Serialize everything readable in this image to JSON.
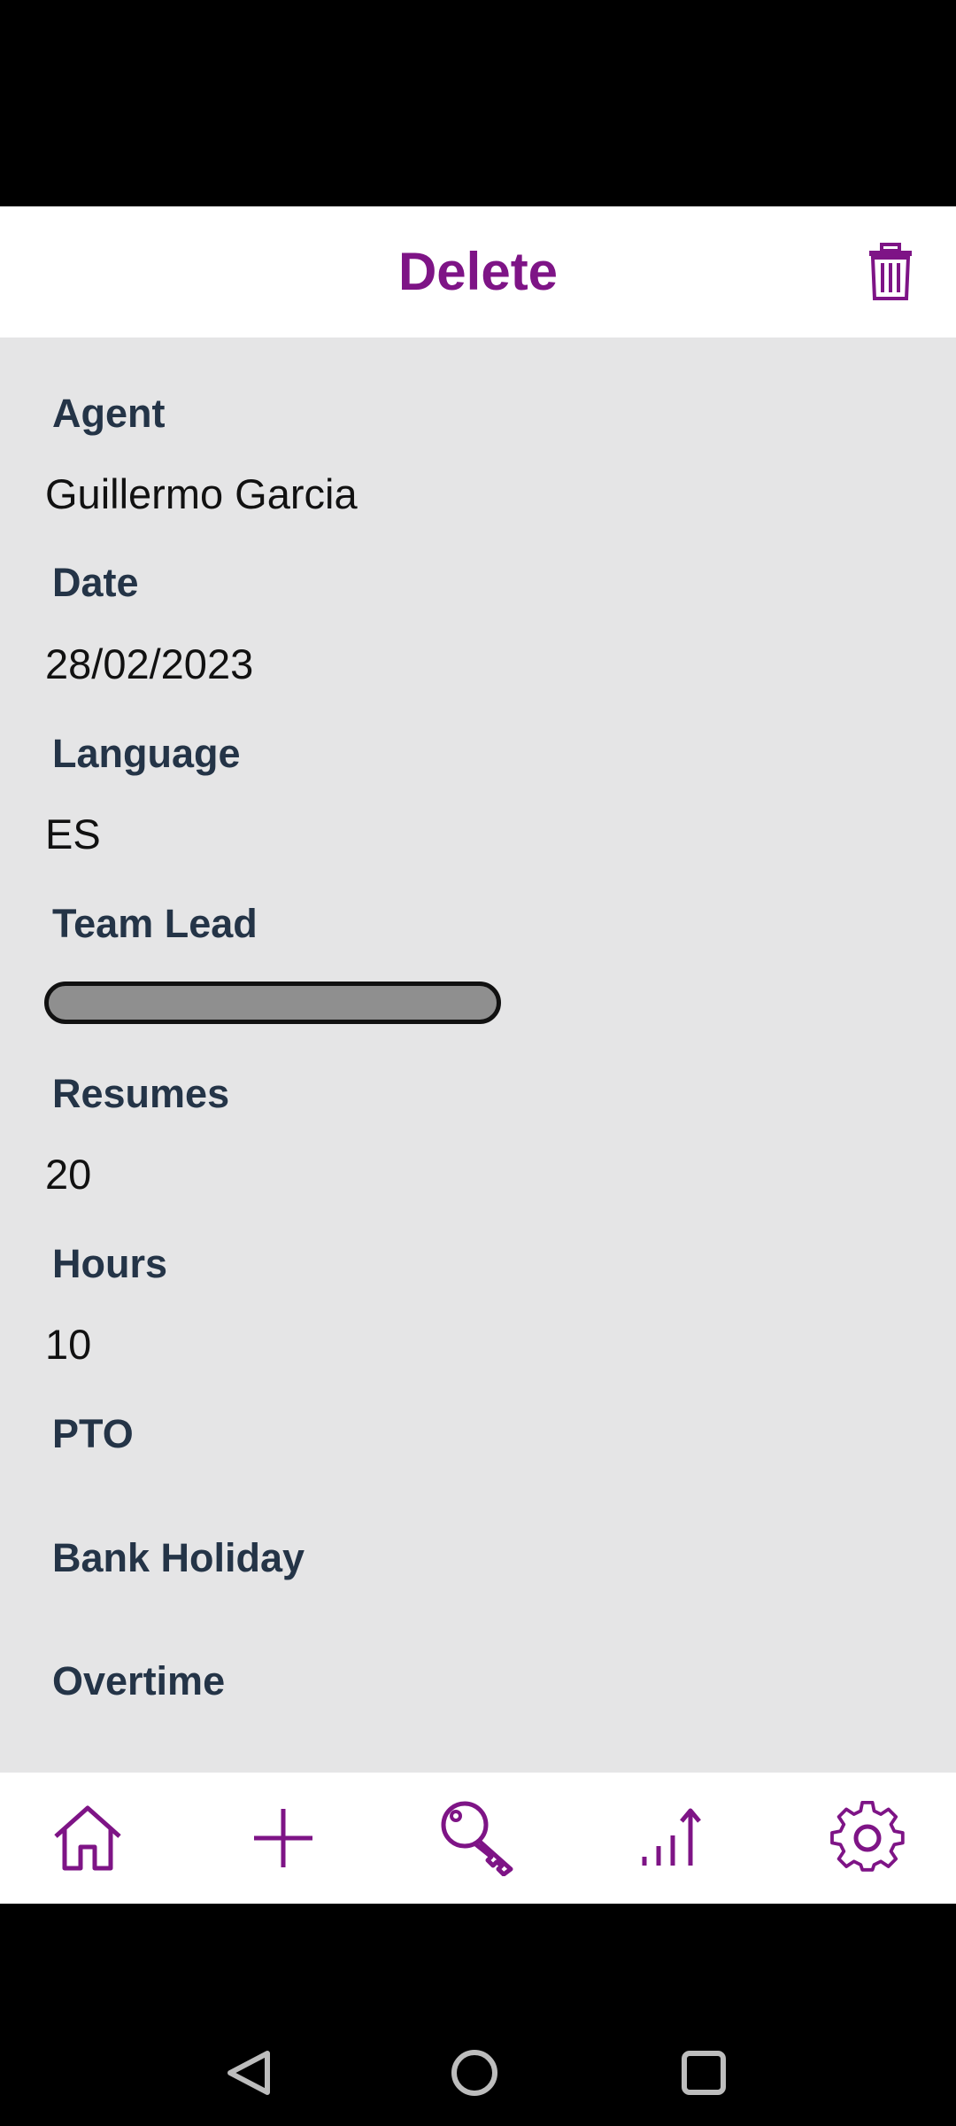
{
  "header": {
    "title": "Delete",
    "action_icon": "trash-icon"
  },
  "fields": {
    "agent": {
      "label": "Agent",
      "value": "Guillermo Garcia"
    },
    "date": {
      "label": "Date",
      "value": "28/02/2023"
    },
    "language": {
      "label": "Language",
      "value": "ES"
    },
    "team_lead": {
      "label": "Team Lead",
      "value": ""
    },
    "resumes": {
      "label": "Resumes",
      "value": "20"
    },
    "hours": {
      "label": "Hours",
      "value": "10"
    },
    "pto": {
      "label": "PTO",
      "value": ""
    },
    "bank_holiday": {
      "label": "Bank Holiday",
      "value": ""
    },
    "overtime": {
      "label": "Overtime",
      "value": ""
    }
  },
  "bottom_nav": [
    "home-icon",
    "plus-icon",
    "key-icon",
    "chart-icon",
    "gear-icon"
  ],
  "system_nav": [
    "back-icon",
    "home-circle-icon",
    "recents-icon"
  ],
  "colors": {
    "accent": "#7e1486",
    "label": "#243447",
    "content_bg": "#e5e5e6"
  }
}
